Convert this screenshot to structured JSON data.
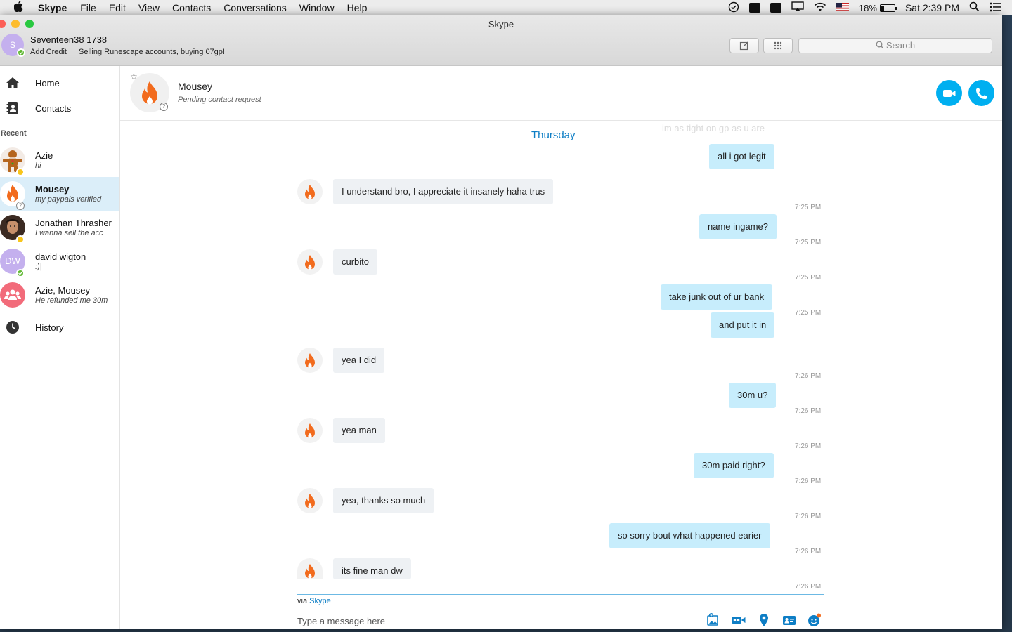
{
  "menubar": {
    "items": [
      "Skype",
      "File",
      "Edit",
      "View",
      "Contacts",
      "Conversations",
      "Window",
      "Help"
    ],
    "battery": "18%",
    "clock": "Sat 2:39 PM"
  },
  "window": {
    "title": "Skype"
  },
  "profile": {
    "initial": "S",
    "name": "Seventeen38 1738",
    "add_credit": "Add Credit",
    "mood": "Selling Runescape accounts, buying 07gp!"
  },
  "search": {
    "placeholder": "Search"
  },
  "sidebar": {
    "home": "Home",
    "contacts": "Contacts",
    "recent_label": "Recent",
    "history": "History",
    "recents": [
      {
        "name": "Azie",
        "preview": "hi",
        "status": "away"
      },
      {
        "name": "Mousey",
        "preview": "my paypals verified",
        "status": "pending",
        "selected": true
      },
      {
        "name": "Jonathan Thrasher",
        "preview": "I wanna sell the acc",
        "status": "away"
      },
      {
        "name": "david wigton",
        "initials": "DW",
        "preview": ":)|",
        "status": "online"
      },
      {
        "name": "Azie, Mousey",
        "preview": "He refunded me 30m",
        "status": "group"
      }
    ]
  },
  "conversation": {
    "name": "Mousey",
    "status": "Pending contact request",
    "day": "Thursday",
    "ghost": "im as tight on gp as u are",
    "messages": [
      {
        "dir": "out",
        "text": "all i got legit",
        "time": ""
      },
      {
        "dir": "in",
        "text": "I understand bro, I appreciate it insanely haha trus",
        "time": "7:25 PM"
      },
      {
        "dir": "out",
        "text": "name ingame?",
        "time": "7:25 PM"
      },
      {
        "dir": "in",
        "text": "curbito",
        "time": "7:25 PM"
      },
      {
        "dir": "out",
        "text": "take junk out of ur bank",
        "time": "7:25 PM"
      },
      {
        "dir": "out",
        "text": "and put it in",
        "time": ""
      },
      {
        "dir": "in",
        "text": "yea I did",
        "time": "7:26 PM"
      },
      {
        "dir": "out",
        "text": "30m u?",
        "time": "7:26 PM"
      },
      {
        "dir": "in",
        "text": "yea man",
        "time": "7:26 PM"
      },
      {
        "dir": "out",
        "text": "30m paid right?",
        "time": "7:26 PM"
      },
      {
        "dir": "in",
        "text": "yea, thanks so much",
        "time": "7:26 PM"
      },
      {
        "dir": "out",
        "text": "so sorry bout what happened earier",
        "time": "7:26 PM"
      },
      {
        "dir": "in",
        "text": "its fine man dw",
        "time": "7:26 PM"
      }
    ],
    "via_prefix": "via",
    "via_service": "Skype",
    "compose_placeholder": "Type a message here"
  },
  "colors": {
    "accent": "#00aff0",
    "bubble_out": "#c7edfc",
    "bubble_in": "#eef1f4",
    "fire": "#f26b1d"
  }
}
